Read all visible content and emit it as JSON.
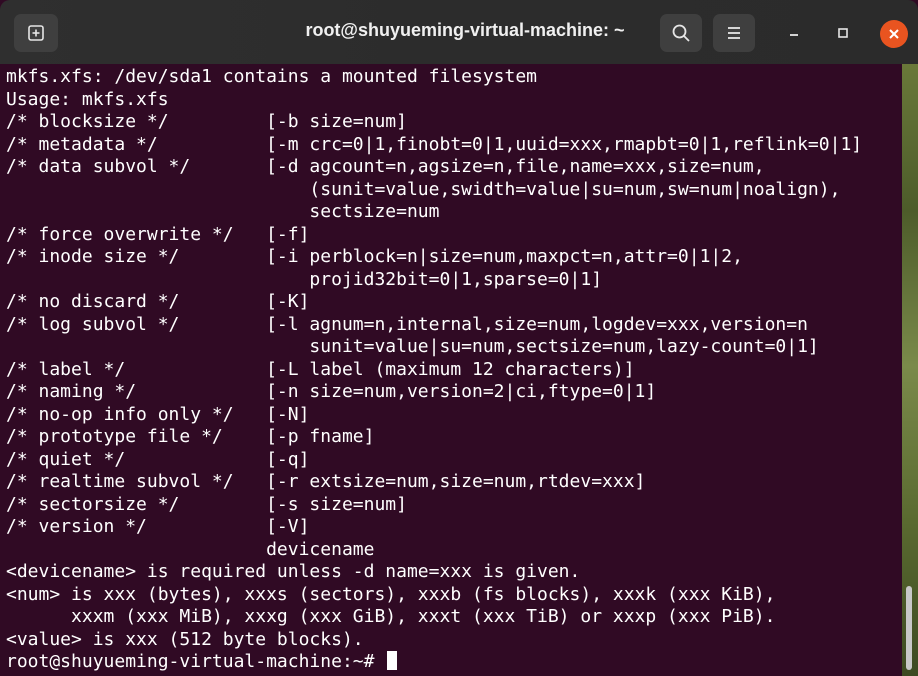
{
  "window": {
    "title": "root@shuyueming-virtual-machine: ~"
  },
  "titlebar": {
    "new_tab_icon": "new-tab-icon",
    "search_icon": "search-icon",
    "menu_icon": "hamburger-menu-icon",
    "minimize_icon": "minimize-icon",
    "maximize_icon": "maximize-icon",
    "close_icon": "close-icon",
    "close_color": "#e95420"
  },
  "terminal": {
    "background": "#300a24",
    "foreground": "#ffffff",
    "lines": [
      "mkfs.xfs: /dev/sda1 contains a mounted filesystem",
      "Usage: mkfs.xfs",
      "/* blocksize */         [-b size=num]",
      "/* metadata */          [-m crc=0|1,finobt=0|1,uuid=xxx,rmapbt=0|1,reflink=0|1]",
      "/* data subvol */       [-d agcount=n,agsize=n,file,name=xxx,size=num,",
      "                            (sunit=value,swidth=value|su=num,sw=num|noalign),",
      "                            sectsize=num",
      "/* force overwrite */   [-f]",
      "/* inode size */        [-i perblock=n|size=num,maxpct=n,attr=0|1|2,",
      "                            projid32bit=0|1,sparse=0|1]",
      "/* no discard */        [-K]",
      "/* log subvol */        [-l agnum=n,internal,size=num,logdev=xxx,version=n",
      "                            sunit=value|su=num,sectsize=num,lazy-count=0|1]",
      "/* label */             [-L label (maximum 12 characters)]",
      "/* naming */            [-n size=num,version=2|ci,ftype=0|1]",
      "/* no-op info only */   [-N]",
      "/* prototype file */    [-p fname]",
      "/* quiet */             [-q]",
      "/* realtime subvol */   [-r extsize=num,size=num,rtdev=xxx]",
      "/* sectorsize */        [-s size=num]",
      "/* version */           [-V]",
      "                        devicename",
      "<devicename> is required unless -d name=xxx is given.",
      "<num> is xxx (bytes), xxxs (sectors), xxxb (fs blocks), xxxk (xxx KiB),",
      "      xxxm (xxx MiB), xxxg (xxx GiB), xxxt (xxx TiB) or xxxp (xxx PiB).",
      "<value> is xxx (512 byte blocks)."
    ],
    "prompt": "root@shuyueming-virtual-machine:~# "
  }
}
